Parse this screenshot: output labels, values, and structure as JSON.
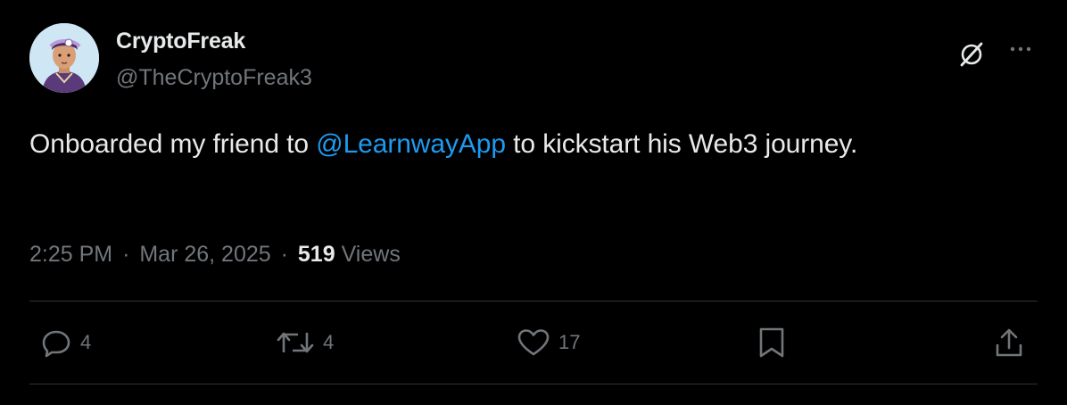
{
  "user": {
    "display_name": "CryptoFreak",
    "handle": "@TheCryptoFreak3"
  },
  "tweet": {
    "text_before": "Onboarded my friend to ",
    "mention": "@LearnwayApp",
    "text_after": " to kickstart his Web3 journey."
  },
  "meta": {
    "time": "2:25 PM",
    "dot1": "·",
    "date": "Mar 26, 2025",
    "dot2": "·",
    "views_count": "519",
    "views_label": "Views"
  },
  "actions": {
    "reply_count": "4",
    "retweet_count": "4",
    "like_count": "17"
  },
  "icons": {
    "header": [
      "grok-icon",
      "more-icon"
    ],
    "actions": [
      "reply-icon",
      "retweet-icon",
      "like-icon",
      "bookmark-icon",
      "share-icon"
    ]
  },
  "colors": {
    "background": "#000000",
    "primary_text": "#e7e9ea",
    "secondary_text": "#71767b",
    "link": "#1d9bf0",
    "divider": "#2f3336"
  }
}
